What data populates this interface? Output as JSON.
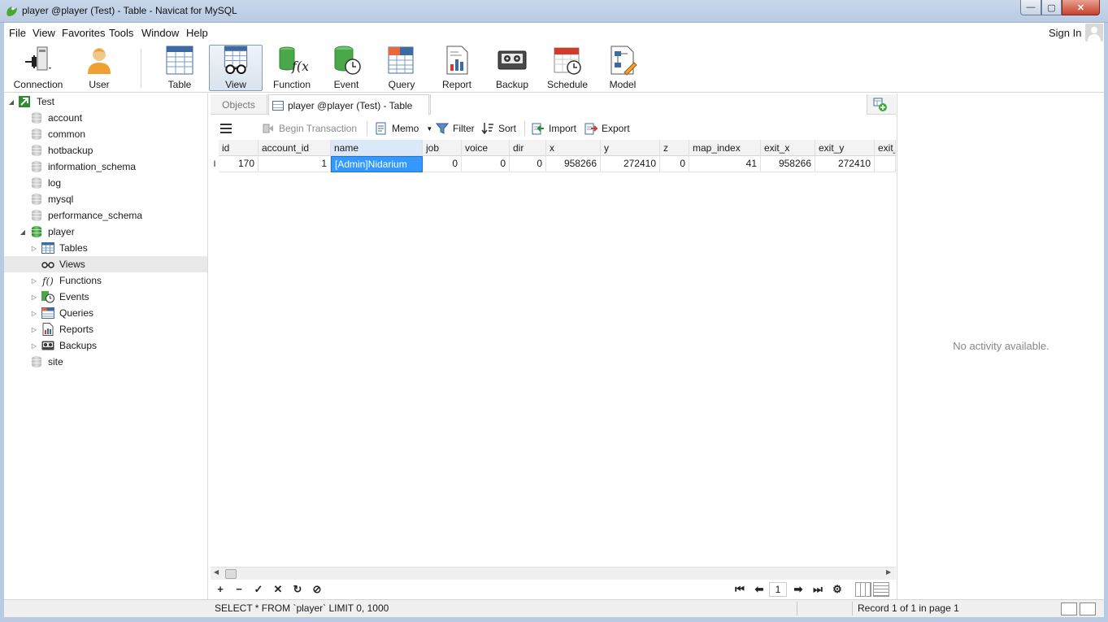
{
  "window": {
    "title": "player @player (Test) - Table - Navicat for MySQL",
    "min_symbol": "—",
    "max_symbol": "▢",
    "close_symbol": "✕"
  },
  "menu": {
    "file": "File",
    "view": "View",
    "favorites": "Favorites",
    "tools": "Tools",
    "window": "Window",
    "help": "Help",
    "sign_in": "Sign In"
  },
  "toolbar": {
    "connection": "Connection",
    "user": "User",
    "table": "Table",
    "view": "View",
    "function": "Function",
    "event": "Event",
    "query": "Query",
    "report": "Report",
    "backup": "Backup",
    "schedule": "Schedule",
    "model": "Model"
  },
  "sidebar": {
    "connection": "Test",
    "databases": [
      {
        "label": "account"
      },
      {
        "label": "common"
      },
      {
        "label": "hotbackup"
      },
      {
        "label": "information_schema"
      },
      {
        "label": "log"
      },
      {
        "label": "mysql"
      },
      {
        "label": "performance_schema"
      },
      {
        "label": "player"
      }
    ],
    "player_children": [
      {
        "label": "Tables"
      },
      {
        "label": "Views"
      },
      {
        "label": "Functions"
      },
      {
        "label": "Events"
      },
      {
        "label": "Queries"
      },
      {
        "label": "Reports"
      },
      {
        "label": "Backups"
      }
    ],
    "last_db": "site"
  },
  "tabs": {
    "objects": "Objects",
    "active": "player @player (Test) - Table"
  },
  "grid_toolbar": {
    "begin_transaction": "Begin Transaction",
    "memo": "Memo",
    "filter": "Filter",
    "sort": "Sort",
    "import": "Import",
    "export": "Export"
  },
  "table": {
    "columns": [
      "id",
      "account_id",
      "name",
      "job",
      "voice",
      "dir",
      "x",
      "y",
      "z",
      "map_index",
      "exit_x",
      "exit_y",
      "exit_"
    ],
    "rows": [
      [
        "170",
        "1",
        "[Admin]Nidarium",
        "0",
        "0",
        "0",
        "958266",
        "272410",
        "0",
        "41",
        "958266",
        "272410",
        ""
      ]
    ],
    "row_indicator": "I"
  },
  "pagination": {
    "page": "1"
  },
  "activity": {
    "empty_text": "No activity available."
  },
  "status": {
    "sql": "SELECT * FROM `player` LIMIT 0, 1000",
    "record": "Record 1 of 1 in page 1"
  },
  "colors": {
    "selection": "#3399ff",
    "titlebar": "#b9cbe3",
    "db_active": "#2e8a2e"
  }
}
